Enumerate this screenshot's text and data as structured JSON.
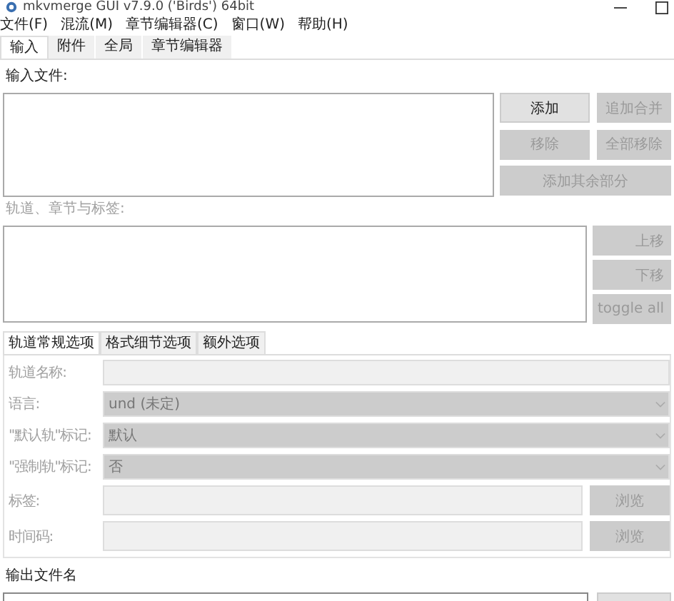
{
  "window": {
    "title": "mkvmerge GUI v7.9.0 ('Birds') 64bit"
  },
  "menu": [
    "文件(F)",
    "混流(M)",
    "章节编辑器(C)",
    "窗口(W)",
    "帮助(H)"
  ],
  "tabs": [
    {
      "label": "输入",
      "selected": true
    },
    {
      "label": "附件",
      "selected": false
    },
    {
      "label": "全局",
      "selected": false
    },
    {
      "label": "章节编辑器",
      "selected": false
    }
  ],
  "input_files": {
    "label": "输入文件:",
    "buttons": [
      {
        "label": "添加",
        "disabled": false
      },
      {
        "label": "追加合并",
        "disabled": true
      },
      {
        "label": "移除",
        "disabled": true
      },
      {
        "label": "全部移除",
        "disabled": true
      },
      {
        "label": "添加其余部分",
        "disabled": true
      }
    ]
  },
  "tracks": {
    "label": "轨道、章节与标签:",
    "disabled": true,
    "buttons": [
      {
        "label": "上移",
        "disabled": true
      },
      {
        "label": "下移",
        "disabled": true
      },
      {
        "label": "toggle all",
        "disabled": true
      }
    ]
  },
  "sub_tabs": [
    {
      "label": "轨道常规选项",
      "selected": true
    },
    {
      "label": "格式细节选项",
      "selected": false
    },
    {
      "label": "额外选项",
      "selected": false
    }
  ],
  "fields": [
    {
      "kind": "text",
      "label": "轨道名称:",
      "disabled": true
    },
    {
      "kind": "dropdown",
      "label": "语言:",
      "value": "und (未定)",
      "disabled": true
    },
    {
      "kind": "dropdown",
      "label": "\"默认轨\"标记:",
      "value": "默认",
      "disabled": true
    },
    {
      "kind": "dropdown",
      "label": "\"强制轨\"标记:",
      "value": "否",
      "disabled": true
    },
    {
      "kind": "browse",
      "label": "标签:",
      "button": "浏览",
      "disabled": true
    },
    {
      "kind": "browse",
      "label": "时间码:",
      "button": "浏览",
      "disabled": true
    }
  ],
  "output": {
    "label": "输出文件名"
  }
}
